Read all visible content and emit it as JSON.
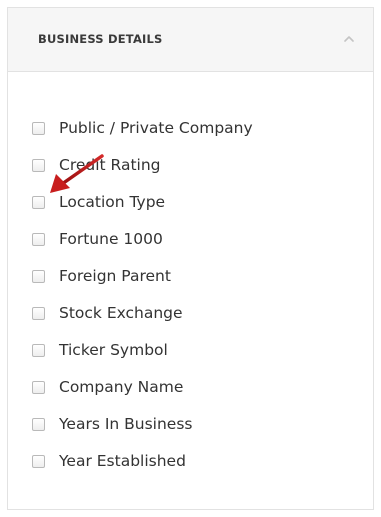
{
  "panel": {
    "title": "BUSINESS DETAILS",
    "collapse_icon": "chevron-up-icon"
  },
  "options": [
    {
      "label": "Public / Private Company",
      "checked": false
    },
    {
      "label": "Credit Rating",
      "checked": false
    },
    {
      "label": "Location Type",
      "checked": false
    },
    {
      "label": "Fortune 1000",
      "checked": false
    },
    {
      "label": "Foreign Parent",
      "checked": false
    },
    {
      "label": "Stock Exchange",
      "checked": false
    },
    {
      "label": "Ticker Symbol",
      "checked": false
    },
    {
      "label": "Company Name",
      "checked": false
    },
    {
      "label": "Years In Business",
      "checked": false
    },
    {
      "label": "Year Established",
      "checked": false
    }
  ],
  "annotation": {
    "icon": "red-arrow-icon",
    "color": "#c81e1e"
  }
}
